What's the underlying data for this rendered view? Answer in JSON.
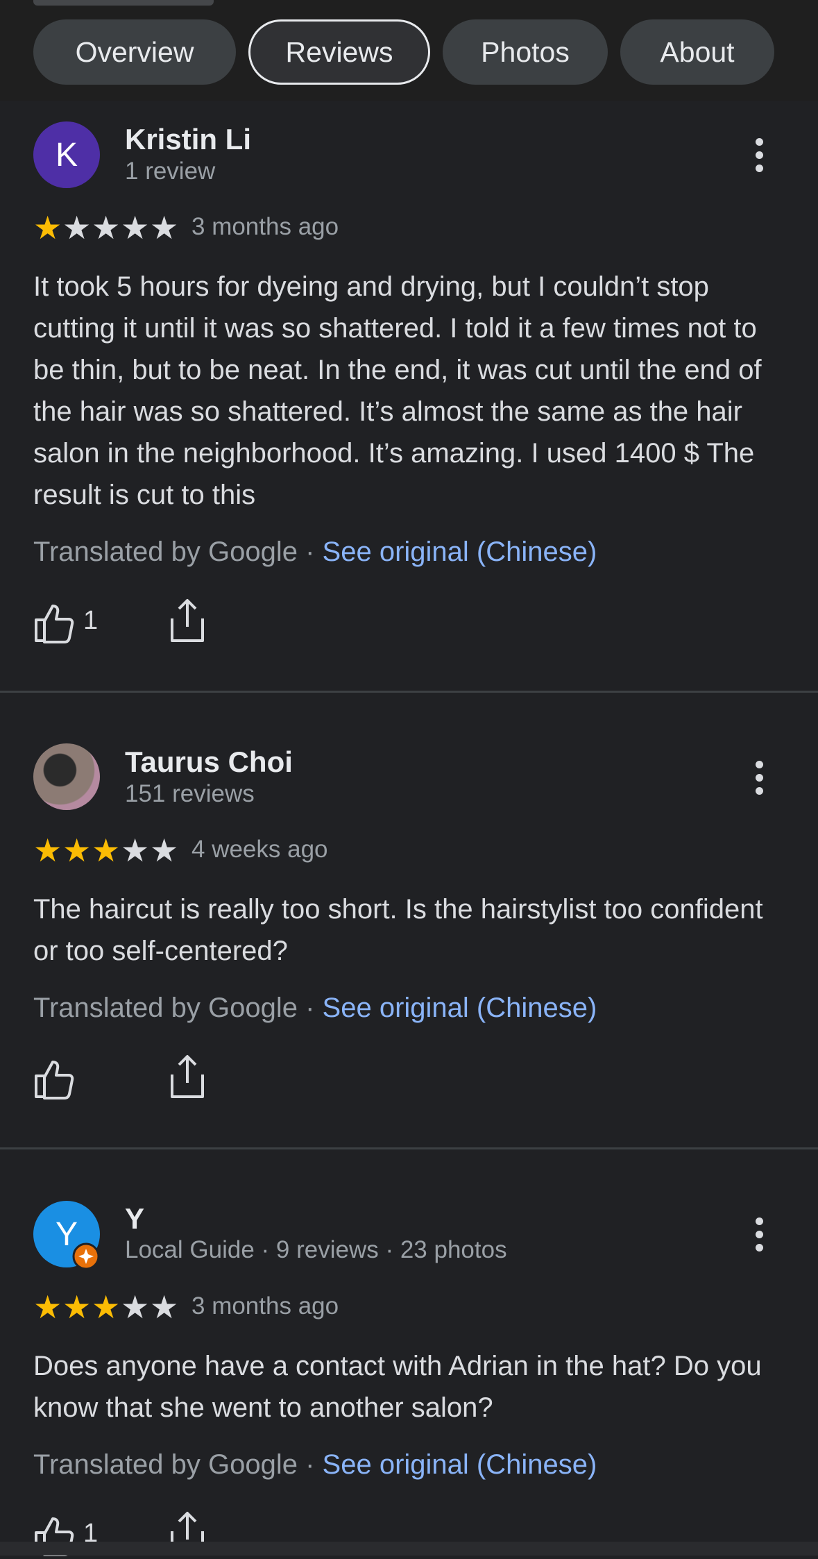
{
  "tabs": [
    "Overview",
    "Reviews",
    "Photos",
    "About"
  ],
  "reviews": [
    {
      "avatar_letter": "K",
      "avatar_color": "#4e2fa6",
      "name": "Kristin Li",
      "meta": "1 review",
      "rating": 1,
      "ago": "3 months ago",
      "text": "It took 5 hours for dyeing and drying, but I couldn’t stop cutting it until it was so shattered. I told it a few times not to be thin, but to be neat. In the end, it was cut until the end of the hair was so shattered. It’s almost the same as the hair salon in the neighborhood. It’s amazing. I used 1400 $ The result is cut to this",
      "translated_by": "Translated by Google",
      "separator": "·",
      "see_original": "See original (Chinese)",
      "likes": "1"
    },
    {
      "avatar_letter": "",
      "avatar_color": "#6b5b55",
      "name": "Taurus Choi",
      "meta": "151 reviews",
      "rating": 3,
      "ago": "4 weeks ago",
      "text": "The haircut is really too short. Is the hairstylist too confident or too self-centered?",
      "translated_by": "Translated by Google",
      "separator": "·",
      "see_original": "See original (Chinese)",
      "likes": ""
    },
    {
      "avatar_letter": "Y",
      "avatar_color": "#1a8fe3",
      "name": "Y",
      "meta": "Local Guide · 9 reviews · 23 photos",
      "rating": 3,
      "ago": "3 months ago",
      "text": "Does anyone have a contact with Adrian in the hat? Do you know that she went to another salon?",
      "translated_by": "Translated by Google",
      "separator": "·",
      "see_original": "See original (Chinese)",
      "likes": "1"
    }
  ],
  "colors": {
    "star_on": "#fbbc04",
    "star_off": "#dadce0",
    "link": "#8ab4f8",
    "badge": "#e8710a"
  }
}
